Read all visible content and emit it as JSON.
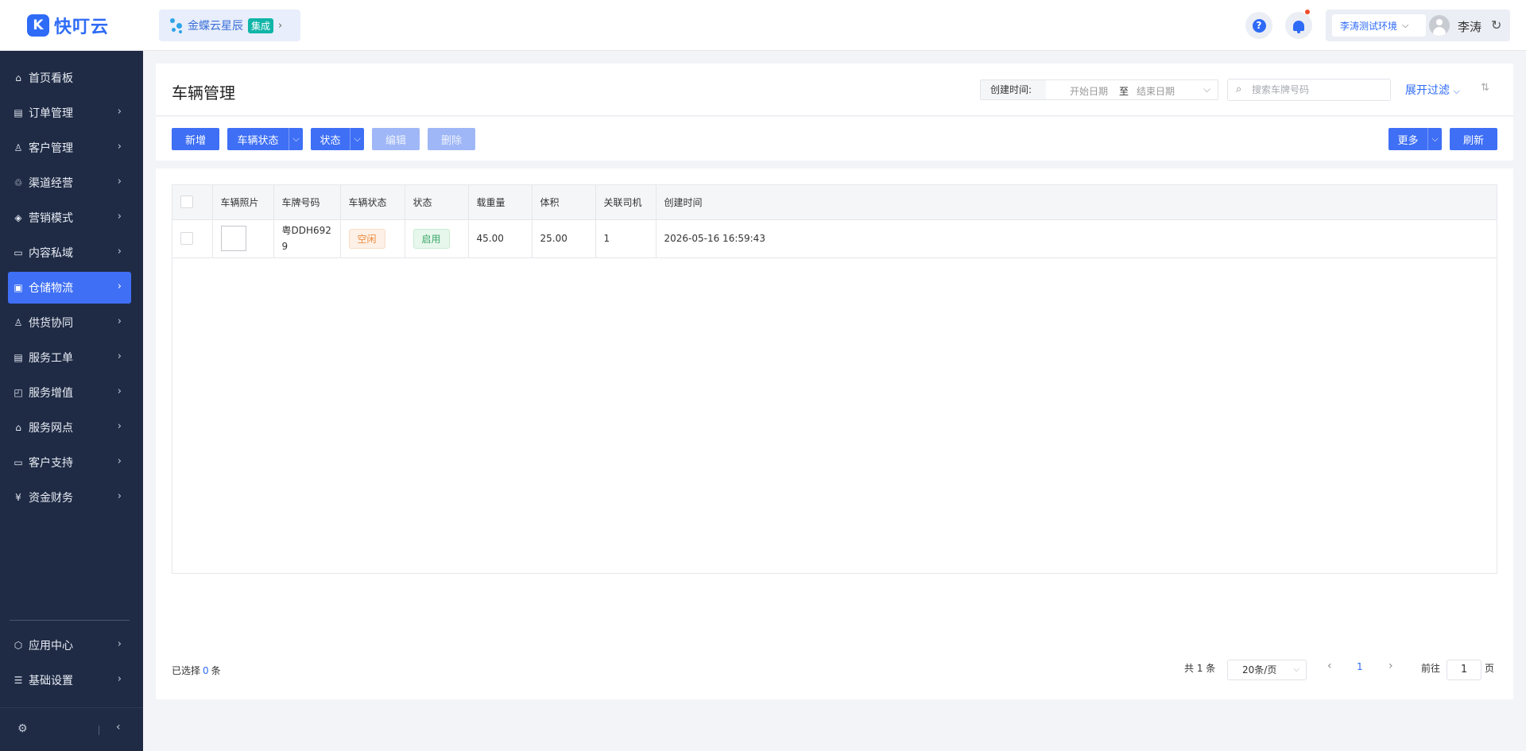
{
  "app": {
    "logo_text": "快叮云",
    "logo_mark": "K",
    "integration_name": "金蝶云星辰",
    "integration_badge": "集成"
  },
  "topbar": {
    "help_icon": "?",
    "env_select": "李涛测试环境",
    "user_name": "李涛"
  },
  "sidebar": {
    "items": [
      {
        "label": "首页看板",
        "icon": "home-icon",
        "glyph": "⌂"
      },
      {
        "label": "订单管理",
        "icon": "order-icon",
        "glyph": "▤"
      },
      {
        "label": "客户管理",
        "icon": "customer-icon",
        "glyph": "♙"
      },
      {
        "label": "渠道经营",
        "icon": "channel-icon",
        "glyph": "♲"
      },
      {
        "label": "营销模式",
        "icon": "tag-icon",
        "glyph": "◈"
      },
      {
        "label": "内容私域",
        "icon": "image-icon",
        "glyph": "▭"
      },
      {
        "label": "仓储物流",
        "icon": "warehouse-icon",
        "glyph": "▣"
      },
      {
        "label": "供货协同",
        "icon": "supply-icon",
        "glyph": "♙"
      },
      {
        "label": "服务工单",
        "icon": "ticket-icon",
        "glyph": "▤"
      },
      {
        "label": "服务增值",
        "icon": "bag-icon",
        "glyph": "◰"
      },
      {
        "label": "服务网点",
        "icon": "store-icon",
        "glyph": "⌂"
      },
      {
        "label": "客户支持",
        "icon": "support-icon",
        "glyph": "▭"
      },
      {
        "label": "资金财务",
        "icon": "finance-icon",
        "glyph": "¥"
      }
    ],
    "bottom_items": [
      {
        "label": "应用中心",
        "icon": "app-center-icon",
        "glyph": "⬡"
      },
      {
        "label": "基础设置",
        "icon": "settings-icon",
        "glyph": "☰"
      }
    ],
    "active_label": "仓储物流"
  },
  "page": {
    "title": "车辆管理",
    "date_label": "创建时间:",
    "date_start_placeholder": "开始日期",
    "date_separator": "至",
    "date_end_placeholder": "结束日期",
    "search_placeholder": "搜索车牌号码",
    "expand_filter": "展开过滤"
  },
  "toolbar": {
    "add": "新增",
    "vehicle_status": "车辆状态",
    "status": "状态",
    "edit": "编辑",
    "delete": "删除",
    "more": "更多",
    "refresh": "刷新"
  },
  "table": {
    "columns": [
      "车辆照片",
      "车牌号码",
      "车辆状态",
      "状态",
      "载重量",
      "体积",
      "关联司机",
      "创建时间"
    ],
    "rows": [
      {
        "plate_line1": "粤DDH692",
        "plate_line2": "9",
        "vehicle_status": "空闲",
        "status": "启用",
        "load": "45.00",
        "volume": "25.00",
        "driver": "1",
        "created": "2026-05-16 16:59:43"
      }
    ]
  },
  "footer": {
    "selected_prefix": "已选择",
    "selected_count": "0",
    "selected_suffix": "条",
    "total": "共 1 条",
    "page_size": "20条/页",
    "current_page": "1",
    "goto_prefix": "前往",
    "goto_value": "1",
    "goto_suffix": "页"
  },
  "colors": {
    "primary": "#3e6ff5",
    "sidebar_bg": "#1f2b45",
    "tag_warn": "#ee8a3c",
    "tag_ok": "#3ba76a"
  }
}
